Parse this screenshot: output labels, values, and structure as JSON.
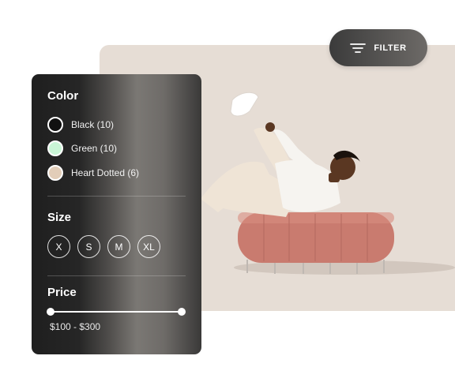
{
  "filter_button": {
    "label": "FILTER",
    "icon": "filter-lines-icon"
  },
  "panel": {
    "color": {
      "title": "Color",
      "options": [
        {
          "label": "Black (10)",
          "swatch": "#111111"
        },
        {
          "label": "Green (10)",
          "swatch": "#c9f5d6"
        },
        {
          "label": "Heart Dotted (6)",
          "swatch": "#e2cdb8"
        }
      ]
    },
    "size": {
      "title": "Size",
      "options": [
        "X",
        "S",
        "M",
        "XL"
      ]
    },
    "price": {
      "title": "Price",
      "range_label": "$100 - $300",
      "min_position": 0,
      "max_position": 1
    }
  },
  "colors": {
    "hero_background": "#e6ddd5",
    "ottoman": "#c97b6f",
    "panel_dark": "#1f1f1f"
  }
}
